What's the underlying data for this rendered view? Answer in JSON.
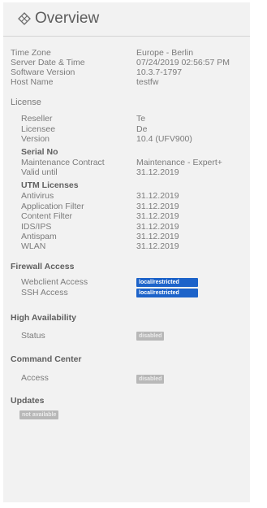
{
  "header": {
    "title": "Overview",
    "icon": "diamond-grid-icon"
  },
  "general": [
    {
      "label": "Time Zone",
      "value": "Europe - Berlin"
    },
    {
      "label": "Server Date & Time",
      "value": "07/24/2019 02:56:57 PM"
    },
    {
      "label": "Software Version",
      "value": "10.3.7-1797"
    },
    {
      "label": "Host Name",
      "value": "testfw"
    }
  ],
  "license": {
    "title": "License",
    "items": [
      {
        "label": "Reseller",
        "value": "Te"
      },
      {
        "label": "Licensee",
        "value": "De"
      },
      {
        "label": "Version",
        "value": "10.4 (UFV900)"
      }
    ],
    "serial_no": {
      "title": "Serial No",
      "items": [
        {
          "label": "Maintenance Contract",
          "value": "Maintenance - Expert+"
        },
        {
          "label": "Valid until",
          "value": "31.12.2019"
        }
      ]
    },
    "utm_licenses": {
      "title": "UTM Licenses",
      "items": [
        {
          "label": "Antivirus",
          "value": "31.12.2019"
        },
        {
          "label": "Application Filter",
          "value": "31.12.2019"
        },
        {
          "label": "Content Filter",
          "value": "31.12.2019"
        },
        {
          "label": "IDS/IPS",
          "value": "31.12.2019"
        },
        {
          "label": "Antispam",
          "value": "31.12.2019"
        },
        {
          "label": "WLAN",
          "value": "31.12.2019"
        }
      ]
    }
  },
  "firewall_access": {
    "title": "Firewall Access",
    "items": [
      {
        "label": "Webclient Access",
        "badge": "local/restricted"
      },
      {
        "label": "SSH Access",
        "badge": "local/restricted"
      }
    ]
  },
  "high_availability": {
    "title": "High Availability",
    "items": [
      {
        "label": "Status",
        "badge": "disabled"
      }
    ]
  },
  "command_center": {
    "title": "Command Center",
    "items": [
      {
        "label": "Access",
        "badge": "disabled"
      }
    ]
  },
  "updates": {
    "title": "Updates",
    "badge": "not available"
  },
  "colors": {
    "panel_bg": "#f2f2f2",
    "badge_blue": "#1d63c9",
    "badge_gray": "#b8b8b8"
  }
}
